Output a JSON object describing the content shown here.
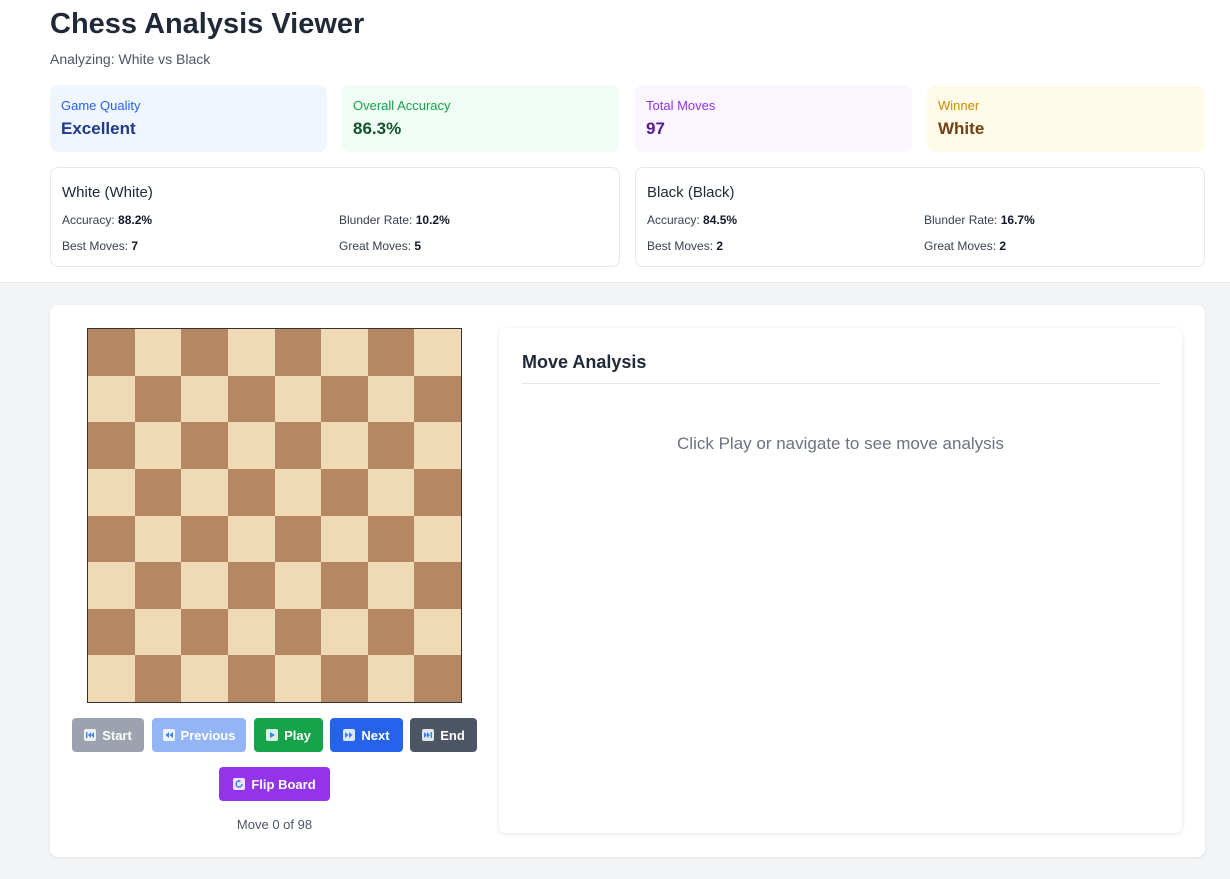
{
  "header": {
    "title": "Chess Analysis Viewer",
    "subtitle": "Analyzing: White vs Black"
  },
  "stats": [
    {
      "label": "Game Quality",
      "value": "Excellent",
      "bg": "#eff6ff",
      "label_color": "#2563eb",
      "value_color": "#1e3a8a"
    },
    {
      "label": "Overall Accuracy",
      "value": "86.3%",
      "bg": "#f0fdf4",
      "label_color": "#16a34a",
      "value_color": "#14532d"
    },
    {
      "label": "Total Moves",
      "value": "97",
      "bg": "#faf5ff",
      "label_color": "#9333ea",
      "value_color": "#581c87"
    },
    {
      "label": "Winner",
      "value": "White",
      "bg": "#fefce8",
      "label_color": "#ca8a04",
      "value_color": "#713f12"
    }
  ],
  "players": [
    {
      "name": "White (White)",
      "accuracy_label": "Accuracy:",
      "accuracy": "88.2%",
      "blunder_label": "Blunder Rate:",
      "blunder": "10.2%",
      "best_label": "Best Moves:",
      "best": "7",
      "great_label": "Great Moves:",
      "great": "5"
    },
    {
      "name": "Black (Black)",
      "accuracy_label": "Accuracy:",
      "accuracy": "84.5%",
      "blunder_label": "Blunder Rate:",
      "blunder": "16.7%",
      "best_label": "Best Moves:",
      "best": "2",
      "great_label": "Great Moves:",
      "great": "2"
    }
  ],
  "board": {
    "light_color": "#f0d9b5",
    "dark_color": "#b58863"
  },
  "controls": {
    "start": "Start",
    "previous": "Previous",
    "play": "Play",
    "next": "Next",
    "end": "End",
    "flip": "Flip Board",
    "move_counter": "Move 0 of 98"
  },
  "analysis": {
    "title": "Move Analysis",
    "placeholder": "Click Play or navigate to see move analysis"
  },
  "icons": {
    "start": "skip-back-icon",
    "previous": "rewind-icon",
    "play": "play-icon",
    "next": "fast-forward-icon",
    "end": "skip-forward-icon",
    "flip": "refresh-icon"
  }
}
